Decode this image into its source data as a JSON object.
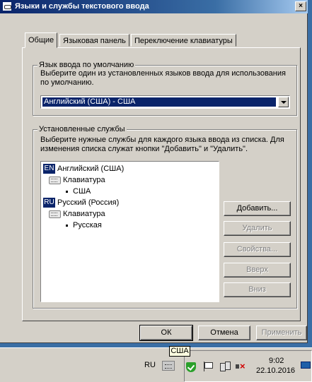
{
  "window": {
    "title": "Языки и службы текстового ввода",
    "close_glyph": "×"
  },
  "tabs": [
    {
      "label": "Общие",
      "active": true
    },
    {
      "label": "Языковая панель",
      "active": false
    },
    {
      "label": "Переключение клавиатуры",
      "active": false
    }
  ],
  "default_language": {
    "group_title": "Язык ввода по умолчанию",
    "description_line1": "Выберите один из установленных языков ввода для использования",
    "description_line2": "по умолчанию.",
    "selected": "Английский (США) - США"
  },
  "installed_services": {
    "group_title": "Установленные службы",
    "description_line1": "Выберите нужные службы для каждого языка ввода из списка. Для",
    "description_line2": "изменения списка служат кнопки \"Добавить\" и \"Удалить\".",
    "tree": {
      "en_code": "EN",
      "en_label": "Английский (США)",
      "en_keyboard": "Клавиатура",
      "en_layout": "США",
      "ru_code": "RU",
      "ru_label": "Русский (Россия)",
      "ru_keyboard": "Клавиатура",
      "ru_layout": "Русская"
    },
    "buttons": {
      "add": "Добавить...",
      "remove": "Удалить",
      "properties": "Свойства...",
      "up": "Вверх",
      "down": "Вниз"
    }
  },
  "dialog_buttons": {
    "ok": "ОК",
    "cancel": "Отмена",
    "apply": "Применить"
  },
  "taskbar": {
    "lang_indicator": "RU",
    "tooltip": "США",
    "time": "9:02",
    "date": "22.10.2016",
    "icons": [
      "keyboard-icon",
      "shield-check-icon",
      "flag-icon",
      "network-icon",
      "sound-muted-icon",
      "show-desktop-icon"
    ]
  },
  "colors": {
    "window_bg": "#d4d0c8",
    "title_gradient_start": "#0a246a",
    "selection": "#0a246a",
    "desktop": "#3a6ea5"
  }
}
